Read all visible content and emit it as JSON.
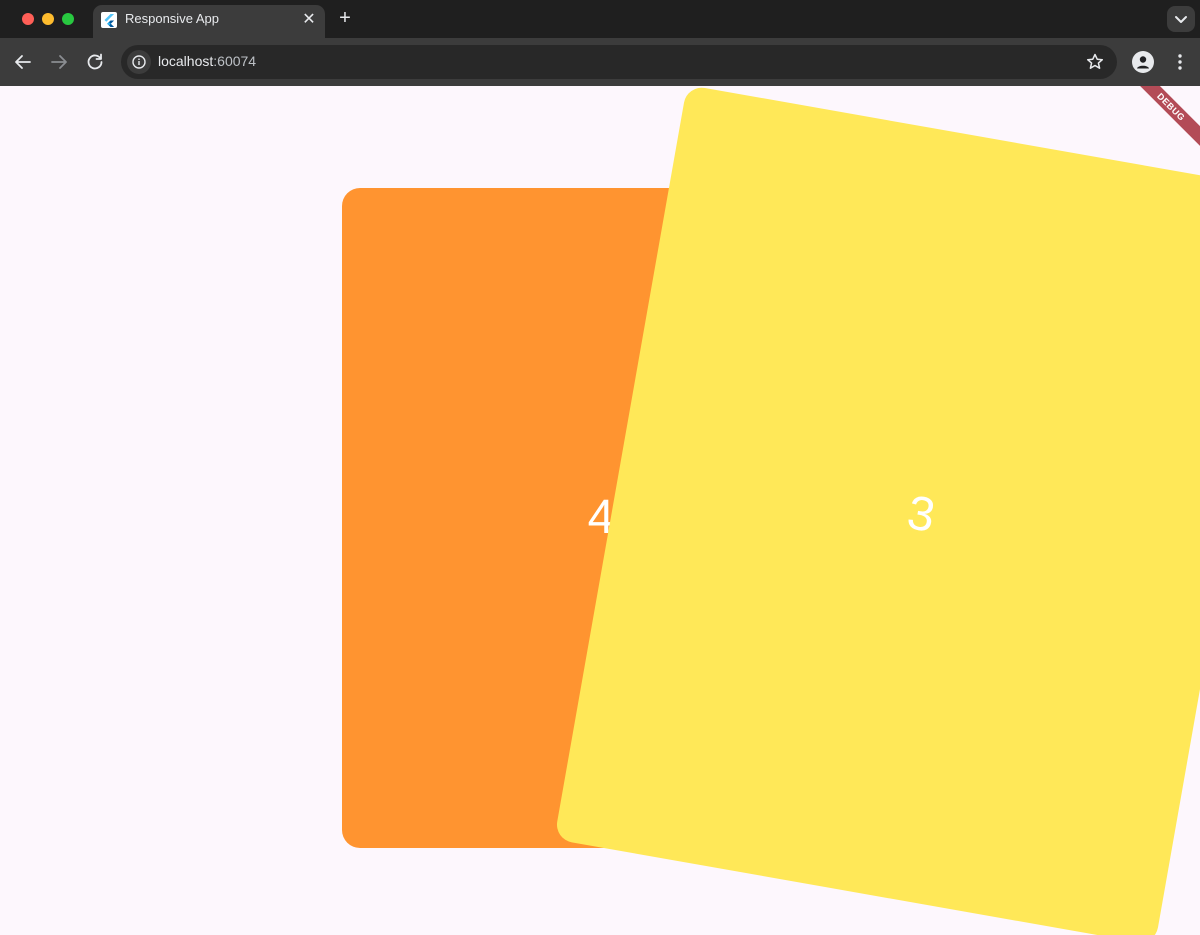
{
  "browser": {
    "tab_title": "Responsive App",
    "close_tab_glyph": "✕",
    "new_tab_glyph": "+",
    "url_host": "localhost",
    "url_port": ":60074",
    "icons": {
      "favicon": "flutter-icon",
      "back": "arrow-left-icon",
      "forward": "arrow-right-icon",
      "reload": "reload-icon",
      "site_info": "info-icon",
      "bookmark": "star-icon",
      "profile": "person-icon",
      "menu": "kebab-menu-icon",
      "tab_search": "chevron-down-icon"
    }
  },
  "app": {
    "debug_banner": "DEBUG",
    "cards": [
      {
        "label": "4",
        "color": "#ff9430"
      },
      {
        "label": "3",
        "color": "#ffe858"
      }
    ]
  }
}
